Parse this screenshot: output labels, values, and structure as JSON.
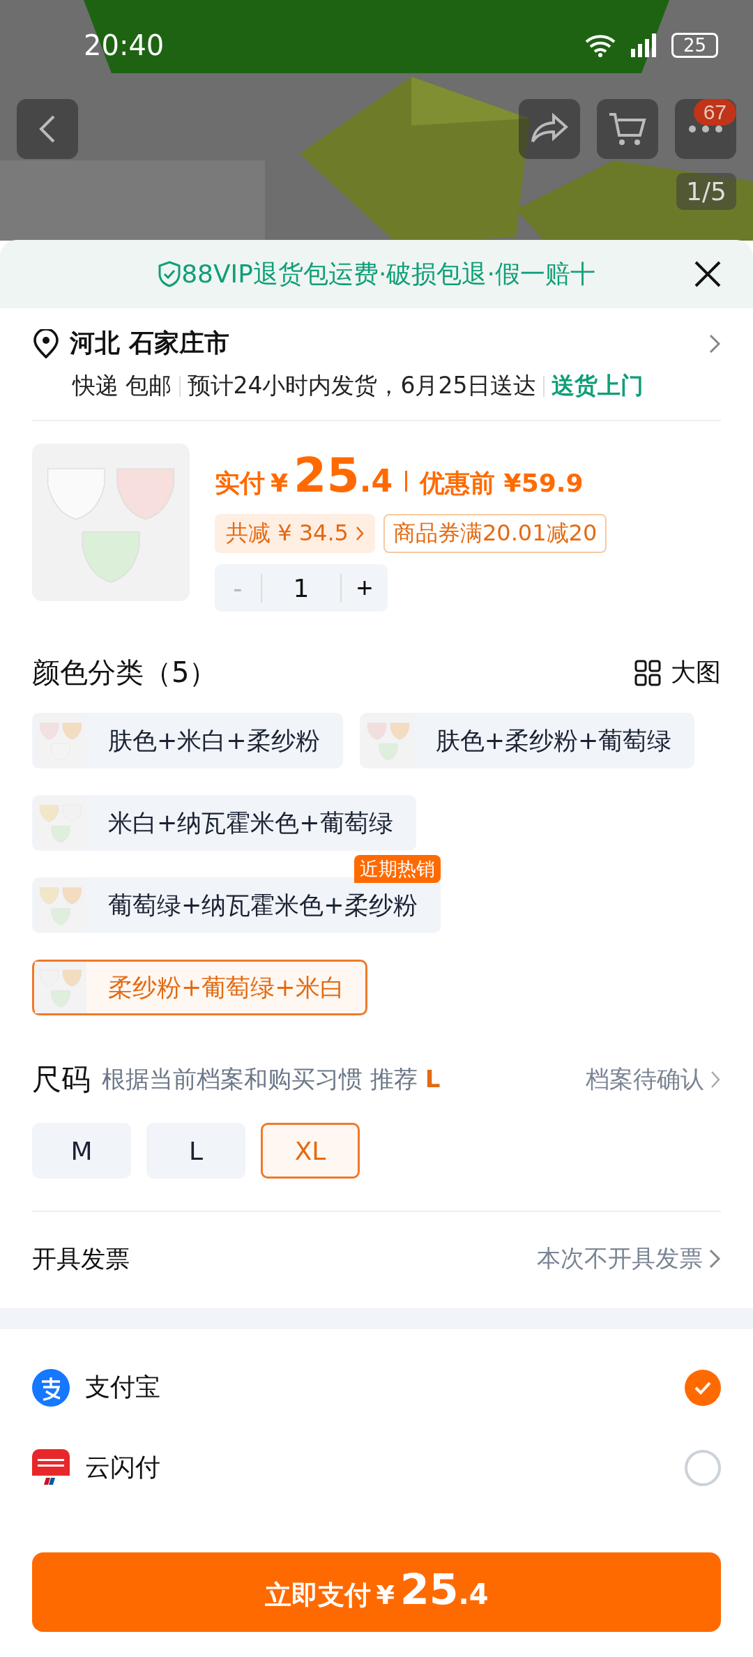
{
  "status_bar": {
    "time": "20:40",
    "battery": "25"
  },
  "header": {
    "image_counter": "1/5",
    "more_badge": "67"
  },
  "guarantee": {
    "text": "88VIP退货包运费·破损包退·假一赔十"
  },
  "address": {
    "region": "河北 石家庄市",
    "shipping": "快递 包邮",
    "estimate": "预计24小时内发货，6月25日送达",
    "delivery_tag": "送货上门"
  },
  "product": {
    "pay_label": "实付",
    "currency": "¥",
    "price_integer": "25",
    "price_decimal": ".4",
    "original_label": "优惠前 ¥59.9",
    "discount": "共减 ¥ 34.5",
    "coupon": "商品券满20.01减20",
    "quantity": {
      "minus": "-",
      "value": "1",
      "plus": "+",
      "minus_disabled": true
    }
  },
  "color_section": {
    "title": "颜色分类（5）",
    "view_toggle": "大图",
    "options": [
      {
        "label": "肤色+米白+柔纱粉",
        "selected": false
      },
      {
        "label": "肤色+柔纱粉+葡萄绿",
        "selected": false
      },
      {
        "label": "米白+纳瓦霍米色+葡萄绿",
        "selected": false
      },
      {
        "label": "葡萄绿+纳瓦霍米色+柔纱粉",
        "selected": false,
        "badge": "近期热销"
      },
      {
        "label": "柔纱粉+葡萄绿+米白",
        "selected": true
      }
    ]
  },
  "size_section": {
    "title": "尺码",
    "hint": "根据当前档案和购买习惯 推荐",
    "recommended": "L",
    "profile_link": "档案待确认",
    "options": [
      {
        "label": "M",
        "selected": false
      },
      {
        "label": "L",
        "selected": false
      },
      {
        "label": "XL",
        "selected": true
      }
    ]
  },
  "invoice": {
    "label": "开具发票",
    "value": "本次不开具发票"
  },
  "payment_methods": [
    {
      "kind": "alipay",
      "label": "支付宝",
      "selected": true
    },
    {
      "kind": "unionpay",
      "label": "云闪付",
      "selected": false
    }
  ],
  "pay_button": {
    "label": "立即支付",
    "currency": "¥",
    "integer": "25",
    "decimal": ".4"
  }
}
